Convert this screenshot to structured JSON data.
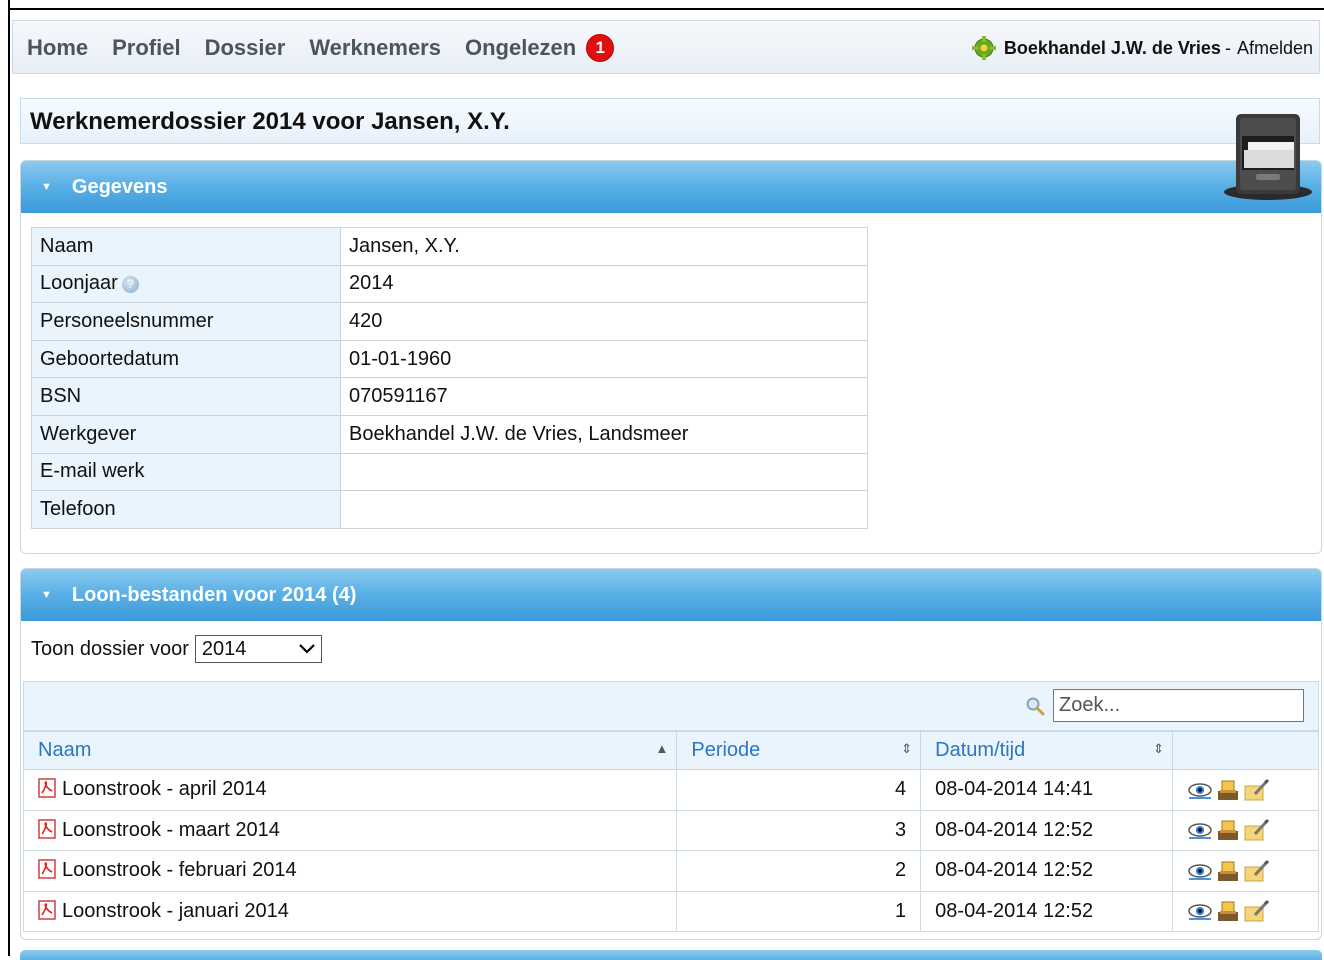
{
  "nav": {
    "items": [
      "Home",
      "Profiel",
      "Dossier",
      "Werknemers",
      "Ongelezen"
    ],
    "unread_count": "1",
    "company": "Boekhandel J.W. de Vries",
    "separator": "-",
    "logout": "Afmelden"
  },
  "page": {
    "title": "Werknemerdossier 2014 voor Jansen, X.Y."
  },
  "gegevens": {
    "header": "Gegevens",
    "rows": [
      {
        "label": "Naam",
        "value": "Jansen, X.Y."
      },
      {
        "label": "Loonjaar",
        "value": "2014"
      },
      {
        "label": "Personeelsnummer",
        "value": "420"
      },
      {
        "label": "Geboortedatum",
        "value": "01-01-1960"
      },
      {
        "label": "BSN",
        "value": "070591167"
      },
      {
        "label": "Werkgever",
        "value": "Boekhandel J.W. de Vries, Landsmeer"
      },
      {
        "label": "E-mail werk",
        "value": ""
      },
      {
        "label": "Telefoon",
        "value": ""
      }
    ]
  },
  "loon": {
    "header": "Loon-bestanden voor 2014 (4)",
    "toon_label": "Toon dossier voor",
    "year_selected": "2014",
    "search_placeholder": "Zoek...",
    "columns": {
      "naam": "Naam",
      "periode": "Periode",
      "datum": "Datum/tijd"
    },
    "rows": [
      {
        "naam": "Loonstrook - april 2014",
        "periode": "4",
        "datum": "08-04-2014 14:41"
      },
      {
        "naam": "Loonstrook - maart 2014",
        "periode": "3",
        "datum": "08-04-2014 12:52"
      },
      {
        "naam": "Loonstrook - februari 2014",
        "periode": "2",
        "datum": "08-04-2014 12:52"
      },
      {
        "naam": "Loonstrook - januari 2014",
        "periode": "1",
        "datum": "08-04-2014 12:52"
      }
    ]
  },
  "colors": {
    "header_blue": "#5cb1e6",
    "light_blue_bg": "#eaf4fc",
    "link_blue": "#2a77bf",
    "badge_red": "#e01010"
  }
}
